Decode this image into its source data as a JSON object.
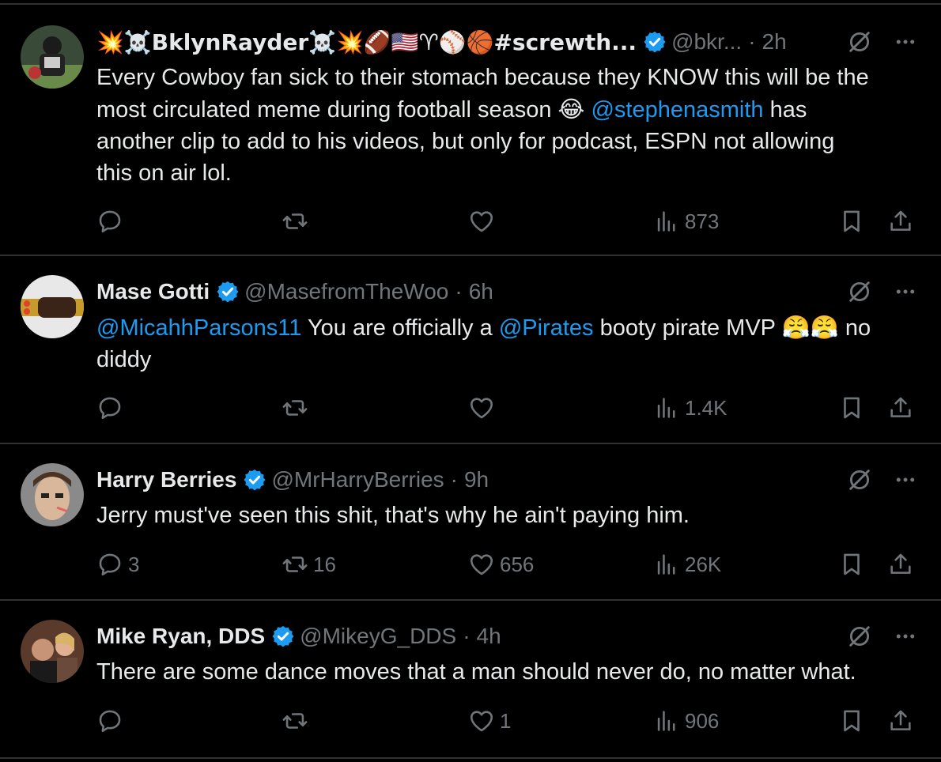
{
  "tweets": [
    {
      "name": "💥☠️BklynRayder☠️💥🏈🇺🇸♈⚾🏀#screwth...",
      "handle": "@bkr...",
      "dot": "·",
      "time": "2h",
      "text_lines": [
        "Every Cowboy fan sick to their stomach because they KNOW this will be the",
        "most circulated meme during football season",
        "another clip to add to his videos, but only for podcast, ESPN not allowing",
        "this on air lol."
      ],
      "emoji": "😂",
      "mention": "@stephenasmith",
      "after_mention": "has",
      "replies": "",
      "reposts": "",
      "likes": "",
      "views": "873"
    },
    {
      "name": "Mase Gotti",
      "handle": "@MasefromTheWoo",
      "dot": "·",
      "time": "6h",
      "mention1": "@MicahhParsons11",
      "text1": "You are officially a",
      "mention2": "@Pirates",
      "text2": "booty pirate MVP",
      "emoji": "😤😤",
      "text3": "no",
      "text4": "diddy",
      "replies": "",
      "reposts": "",
      "likes": "",
      "views": "1.4K"
    },
    {
      "name": "Harry Berries",
      "handle": "@MrHarryBerries",
      "dot": "·",
      "time": "9h",
      "text": "Jerry must've seen this shit, that's why he ain't paying him.",
      "replies": "3",
      "reposts": "16",
      "likes": "656",
      "views": "26K"
    },
    {
      "name": "Mike Ryan, DDS",
      "handle": "@MikeyG_DDS",
      "dot": "·",
      "time": "4h",
      "text": "There are some dance moves that a man should never do, no matter what.",
      "replies": "",
      "reposts": "",
      "likes": "1",
      "views": "906"
    }
  ],
  "colors": {
    "background": "#000000",
    "text": "#e7e9ea",
    "muted": "#71767b",
    "accent": "#1d9bf0",
    "divider": "#2f3336"
  },
  "icons": [
    "verified-icon",
    "grok-icon",
    "more-icon",
    "reply-icon",
    "repost-icon",
    "like-icon",
    "views-icon",
    "bookmark-icon",
    "share-icon"
  ]
}
